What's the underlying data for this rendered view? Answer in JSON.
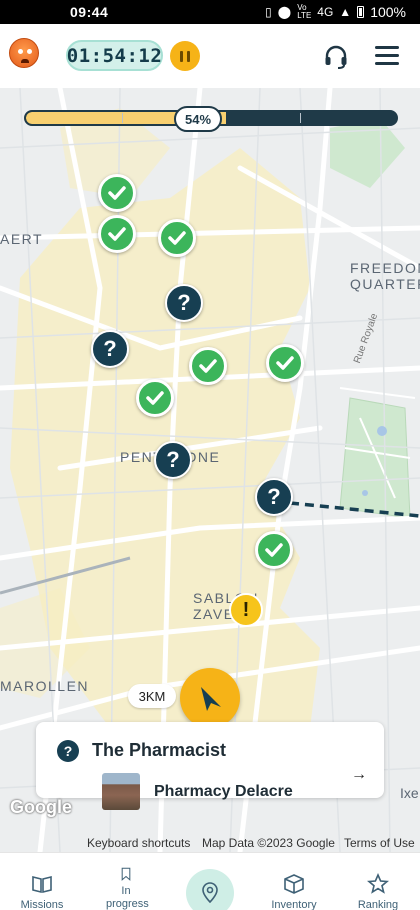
{
  "status_bar": {
    "time": "09:44",
    "network": "4G",
    "battery": "100%",
    "icons": [
      "vibrate-icon",
      "location-icon",
      "volte-icon",
      "signal-icon",
      "battery-icon"
    ]
  },
  "header": {
    "timer": "01:54:12",
    "avatar_icon": "angry-face-icon",
    "pause_icon": "pause-icon",
    "support_icon": "headset-icon",
    "menu_icon": "hamburger-menu-icon"
  },
  "progress": {
    "percent_label": "54%",
    "value": 0.54
  },
  "map": {
    "labels": {
      "aert": "AERT",
      "freedom_line1": "FREEDON",
      "freedom_line2": "QUARTER",
      "pentagone": "PENTAGONE",
      "sablon_line1": "SABLON",
      "sablon_line2": "ZAVEL",
      "marollen": "MAROLLEN",
      "rue_royale": "Rue Royale",
      "ixelles": "Ixe"
    },
    "markers": [
      {
        "type": "done"
      },
      {
        "type": "done"
      },
      {
        "type": "done"
      },
      {
        "type": "unknown",
        "glyph": "?"
      },
      {
        "type": "unknown",
        "glyph": "?"
      },
      {
        "type": "done"
      },
      {
        "type": "done"
      },
      {
        "type": "done"
      },
      {
        "type": "unknown",
        "glyph": "?"
      },
      {
        "type": "unknown",
        "glyph": "?"
      },
      {
        "type": "done"
      },
      {
        "type": "alert",
        "glyph": "!"
      }
    ],
    "distance": "3KM",
    "colors": {
      "done": "#3cb55b",
      "unknown": "#173f52",
      "alert": "#f6c41b",
      "accent": "#f6b317"
    }
  },
  "mission_card": {
    "icon_glyph": "?",
    "title": "The Pharmacist",
    "place": "Pharmacy Delacre",
    "arrow": "→"
  },
  "attribution": {
    "google": "Google",
    "shortcuts": "Keyboard shortcuts",
    "map_data": "Map Data ©2023 Google",
    "terms": "Terms of Use"
  },
  "nav": {
    "missions": "Missions",
    "in_progress": "In progress",
    "inventory": "Inventory",
    "ranking": "Ranking"
  }
}
